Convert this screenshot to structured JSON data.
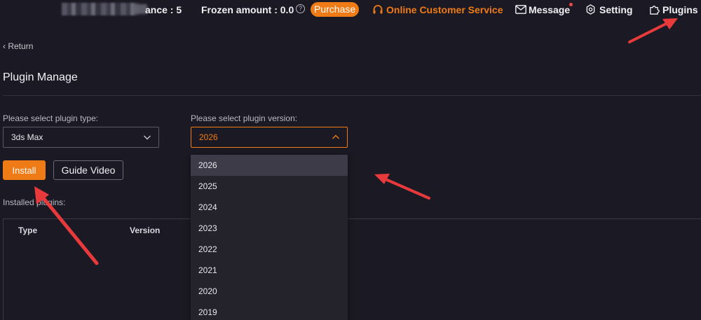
{
  "header": {
    "balance_text": "ance : 5",
    "frozen_text": "Frozen amount : 0.0",
    "help_glyph": "?",
    "purchase_label": "Purchase",
    "customer_service_label": "Online Customer Service",
    "message_label": "Message",
    "setting_label": "Setting",
    "plugins_label": "Plugins"
  },
  "page": {
    "return_label": "Return",
    "title": "Plugin Manage",
    "type_label": "Please select plugin type:",
    "type_value": "3ds Max",
    "version_label": "Please select plugin version:",
    "version_value": "2026",
    "install_label": "Install",
    "guide_label": "Guide Video",
    "installed_label": "Installed plugins:",
    "table_headers": {
      "type": "Type",
      "version": "Version"
    }
  },
  "version_options": [
    "2026",
    "2025",
    "2024",
    "2023",
    "2022",
    "2021",
    "2020",
    "2019"
  ],
  "colors": {
    "accent": "#ef7b16",
    "background": "#1b1a24",
    "dropdown_bg": "#24232c",
    "annotation_arrow": "#e83a3a",
    "notification_dot": "#f04848"
  }
}
